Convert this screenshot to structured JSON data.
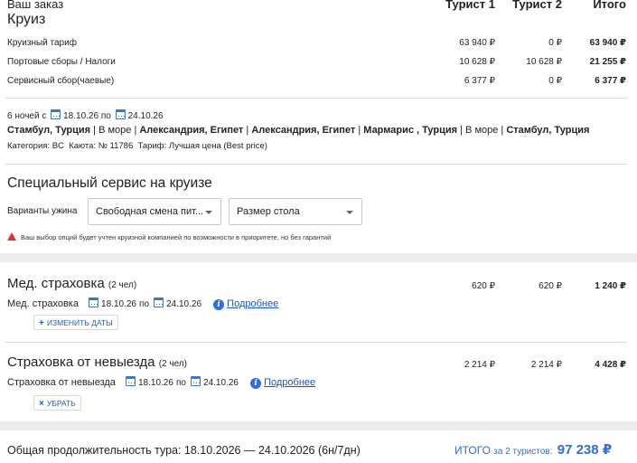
{
  "order": {
    "title": "Ваш заказ",
    "subtitle": "Круиз",
    "col_t1": "Турист 1",
    "col_t2": "Турист 2",
    "col_total": "Итого",
    "rows": [
      {
        "label": "Круизный тариф",
        "t1": "63 940 ₽",
        "t2": "0 ₽",
        "total": "63 940 ₽"
      },
      {
        "label": "Портовые сборы / Налоги",
        "t1": "10 628 ₽",
        "t2": "10 628 ₽",
        "total": "21 255 ₽"
      },
      {
        "label": "Сервисный сбор(чаевые)",
        "t1": "6 377 ₽",
        "t2": "0 ₽",
        "total": "6 377 ₽"
      }
    ]
  },
  "cruise": {
    "nights": "6 ночей с",
    "from": "18.10.26",
    "to_word": "по",
    "to": "24.10.26",
    "route": [
      {
        "text": "Стамбул, Турция",
        "bold": true
      },
      {
        "text": " | В море | ",
        "bold": false
      },
      {
        "text": "Александрия, Египет",
        "bold": true
      },
      {
        "text": " | ",
        "bold": false
      },
      {
        "text": "Александрия, Египет",
        "bold": true
      },
      {
        "text": " | ",
        "bold": false
      },
      {
        "text": "Мармарис , Турция",
        "bold": true
      },
      {
        "text": " | В море | ",
        "bold": false
      },
      {
        "text": "Стамбул, Турция",
        "bold": true
      }
    ],
    "meta": "Категория: BC  Каюта: № 11786  Тариф: Лучшая цена (Best price)"
  },
  "service": {
    "heading": "Специальный сервис на круизе",
    "dinner_label": "Варианты ужина",
    "dinner_value": "Свободная смена пит...",
    "table_value": "Размер стола",
    "warning": "Ваш выбор опций будет учтен круизной компанией по возможности в приоритете, но без гарантий"
  },
  "med": {
    "title": "Мед. страховка",
    "people": "(2 чел)",
    "t1": "620 ₽",
    "t2": "620 ₽",
    "total": "1 240 ₽",
    "label": "Мед. страховка",
    "from": "18.10.26",
    "to_word": "по",
    "to": "24.10.26",
    "more": "Подробнее",
    "button": "ИЗМЕНИТЬ ДАТЫ"
  },
  "noshow": {
    "title": "Страховка от невыезда",
    "people": "(2 чел)",
    "t1": "2 214 ₽",
    "t2": "2 214 ₽",
    "total": "4 428 ₽",
    "label": "Страховка от невыезда",
    "from": "18.10.26",
    "to_word": "по",
    "to": "24.10.26",
    "more": "Подробнее",
    "button": "УБРАТЬ"
  },
  "footer": {
    "duration": "Общая продолжительность тура: 18.10.2026 — 24.10.2026 (6н/7дн)",
    "total_label": "ИТОГО",
    "total_for": "за 2 туристов:",
    "total_value": "97 238 ₽"
  }
}
